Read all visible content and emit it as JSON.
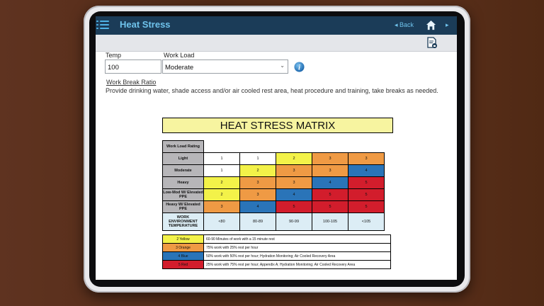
{
  "app": {
    "title": "Heat Stress",
    "back_label": "Back",
    "back_arrow": "◂",
    "forward_arrow": "▸"
  },
  "form": {
    "temp_label": "Temp",
    "temp_value": "100",
    "workload_label": "Work Load",
    "workload_value": "Moderate",
    "info_icon": "i"
  },
  "work_break": {
    "title": "Work Break Ratio",
    "text": "Provide drinking water, shade access and/or air cooled rest area, heat procedure and training, take breaks as needed."
  },
  "matrix": {
    "title": "HEAT STRESS MATRIX",
    "header_label": "Work Load Rating",
    "colors": {
      "1": "#ffffff",
      "2": "#f3f249",
      "3": "#ef9a44",
      "4": "#2a74b8",
      "5": "#d21d2c"
    },
    "rows": [
      {
        "label": "Light",
        "cells": [
          "1",
          "1",
          "2",
          "3",
          "3"
        ]
      },
      {
        "label": "Moderate",
        "cells": [
          "1",
          "2",
          "3",
          "3",
          "4"
        ]
      },
      {
        "label": "Heavy",
        "cells": [
          "2",
          "3",
          "3",
          "4",
          "5"
        ]
      },
      {
        "label": "Low-Mod W/ Elevated PPE",
        "cells": [
          "2",
          "3",
          "4",
          "5",
          "5"
        ]
      },
      {
        "label": "Heavy W/ Elevated PPE",
        "cells": [
          "3",
          "4",
          "5",
          "5",
          "5"
        ]
      }
    ],
    "footer_label": "WORK ENVIRONMENT TEMPERATURE",
    "temperatures": [
      "<80",
      "80-89",
      "90-99",
      "100-105",
      "<105"
    ]
  },
  "legend": [
    {
      "swatch_label": "2 Yellow",
      "level": "2",
      "text": "60-90 Minutes of work with a 15 minute rest"
    },
    {
      "swatch_label": "3 Orange",
      "level": "3",
      "text": "75% work with 25% rest per hour"
    },
    {
      "swatch_label": "4 Blue",
      "level": "4",
      "text": "50% work with 50% rest per hour; Hydration Monitoring; Air Cooled Recovery Area"
    },
    {
      "swatch_label": "5 Red",
      "level": "5",
      "text": "25% work with 75% rest per hour; Appendix A; Hydration Monitoring; Air Cooled Recovery Area"
    }
  ]
}
